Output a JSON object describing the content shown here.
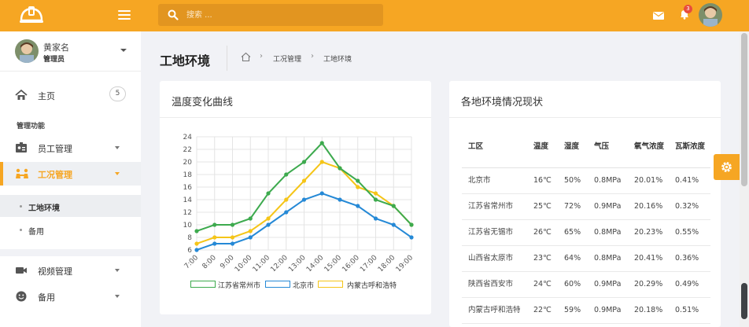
{
  "sidebar": {
    "user_name": "黄家名",
    "user_role": "管理员",
    "nav_home": "主页",
    "nav_home_badge": "5",
    "section_label": "管理功能",
    "nav_staff": "员工管理",
    "nav_site": "工况管理",
    "sub_env": "工地环境",
    "sub_backup": "备用",
    "nav_video": "视频管理",
    "nav_backup": "备用"
  },
  "topbar": {
    "search_placeholder": "搜索 ...",
    "notification_count": "3"
  },
  "page": {
    "title": "工地环境",
    "breadcrumb": [
      "工况管理",
      "工地环境"
    ]
  },
  "chart_panel": {
    "title": "温度变化曲线"
  },
  "table_panel": {
    "title": "各地环境情况现状",
    "columns": [
      "工区",
      "温度",
      "湿度",
      "气压",
      "氧气浓度",
      "瓦斯浓度"
    ],
    "rows": [
      [
        "北京市",
        "16℃",
        "50%",
        "0.8MPa",
        "20.01%",
        "0.41%"
      ],
      [
        "江苏省常州市",
        "25℃",
        "72%",
        "0.9MPa",
        "20.16%",
        "0.32%"
      ],
      [
        "江苏省无锡市",
        "26℃",
        "65%",
        "0.8MPa",
        "20.23%",
        "0.55%"
      ],
      [
        "山西省太原市",
        "23℃",
        "64%",
        "0.8MPa",
        "20.41%",
        "0.36%"
      ],
      [
        "陕西省西安市",
        "24℃",
        "60%",
        "0.9MPa",
        "20.29%",
        "0.49%"
      ],
      [
        "内蒙古呼和浩特",
        "22℃",
        "59%",
        "0.9MPa",
        "20.18%",
        "0.51%"
      ]
    ]
  },
  "colors": {
    "accent": "#f6a623",
    "green": "#3daa4e",
    "blue": "#2589d6",
    "yellow": "#f5c518"
  },
  "chart_data": {
    "type": "line",
    "categories": [
      "7:00",
      "8:00",
      "9:00",
      "10:00",
      "11:00",
      "12:00",
      "13:00",
      "14:00",
      "15:00",
      "16:00",
      "17:00",
      "18:00",
      "19:00"
    ],
    "ylim": [
      6,
      24
    ],
    "yticks": [
      6,
      8,
      10,
      12,
      14,
      16,
      18,
      20,
      22,
      24
    ],
    "grid": true,
    "legend_placement": "bottom",
    "series": [
      {
        "name": "江苏省常州市",
        "color": "#3daa4e",
        "values": [
          9,
          10,
          10,
          11,
          15,
          18,
          20,
          23,
          19,
          17,
          14,
          13,
          10
        ]
      },
      {
        "name": "北京市",
        "color": "#2589d6",
        "values": [
          6,
          7,
          7,
          8,
          10,
          12,
          14,
          15,
          14,
          13,
          11,
          10,
          8
        ]
      },
      {
        "name": "内蒙古呼和浩特",
        "color": "#f5c518",
        "values": [
          7,
          8,
          8,
          9,
          11,
          14,
          17,
          20,
          19,
          16,
          15,
          13,
          10
        ]
      }
    ]
  }
}
